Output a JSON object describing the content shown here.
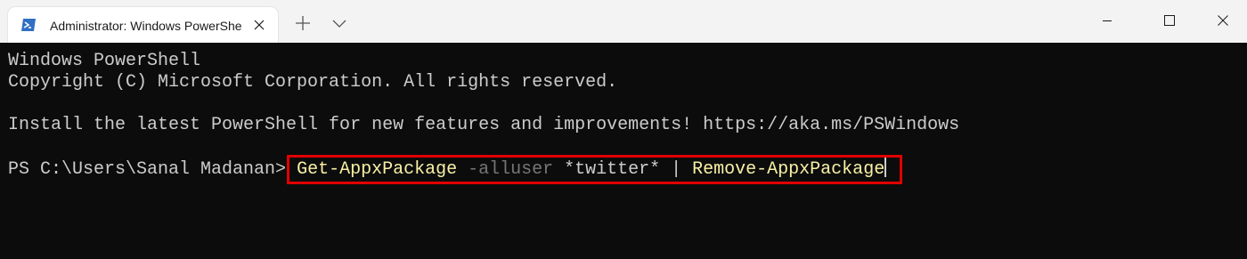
{
  "window": {
    "tab_title": "Administrator: Windows PowerShell",
    "tab_icon": "powershell-icon",
    "controls": [
      "minimize-icon",
      "maximize-icon",
      "close-icon"
    ]
  },
  "terminal": {
    "lines": [
      "Windows PowerShell",
      "Copyright (C) Microsoft Corporation. All rights reserved.",
      "Install the latest PowerShell for new features and improvements! https://aka.ms/PSWindows"
    ],
    "prompt": "PS C:\\Users\\Sanal Madanan> ",
    "command": {
      "cmdlet1": "Get-AppxPackage",
      "param": " -alluser",
      "arg": " *twitter* | ",
      "cmdlet2": "Remove-AppxPackage"
    }
  },
  "colors": {
    "background": "#0c0c0c",
    "text": "#cccccc",
    "cmdlet": "#f9f1a5",
    "parameter": "#767676",
    "highlight_border": "#e00000"
  }
}
